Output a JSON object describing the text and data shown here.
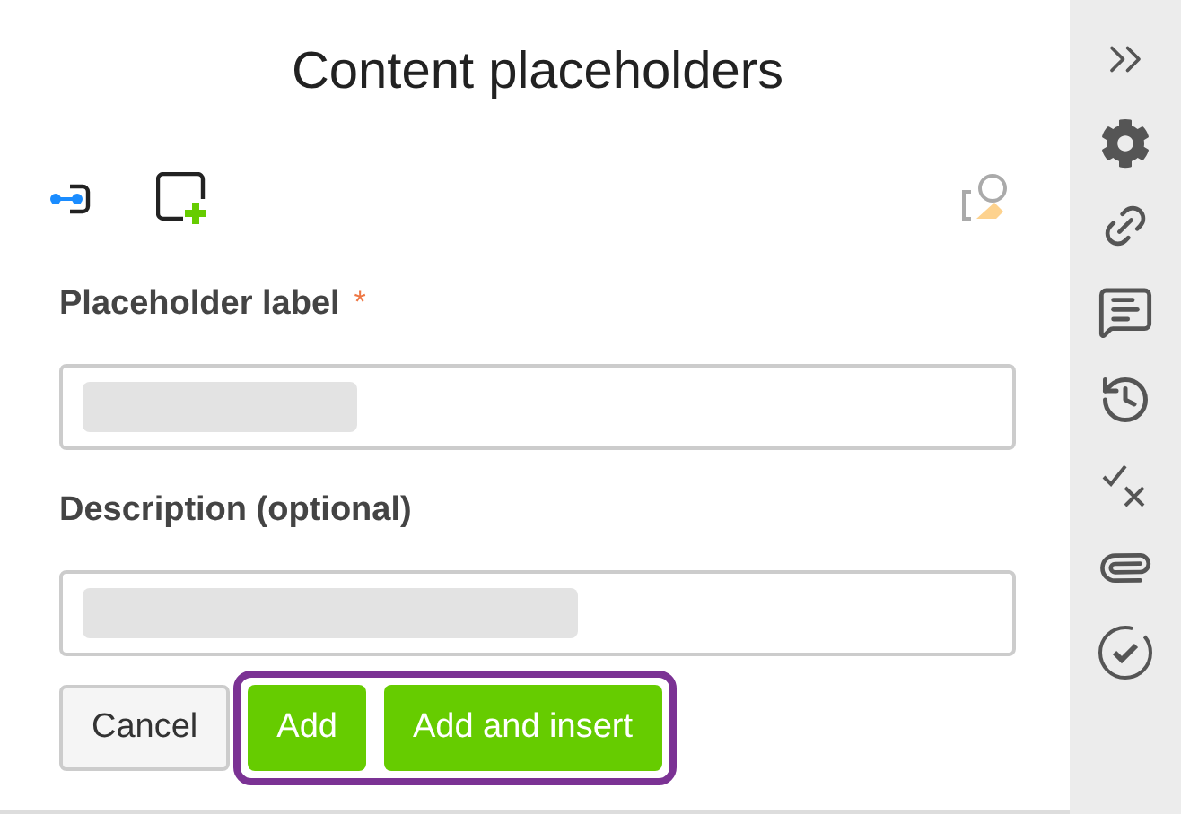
{
  "title": "Content placeholders",
  "fields": [
    {
      "label": "Placeholder label",
      "required_mark": "*"
    },
    {
      "label": "Description (optional)"
    }
  ],
  "buttons": [
    {
      "label": "Cancel",
      "kind": "secondary"
    },
    {
      "label": "Add",
      "kind": "primary"
    },
    {
      "label": "Add and insert",
      "kind": "primary"
    }
  ]
}
